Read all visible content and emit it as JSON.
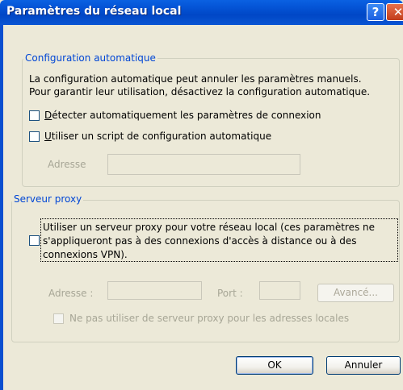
{
  "window": {
    "title": "Paramètres du réseau local",
    "help_label": "?",
    "close_label": "✕"
  },
  "auto_config": {
    "legend": "Configuration automatique",
    "description_line1": "La configuration automatique peut annuler les paramètres manuels.",
    "description_line2": "Pour garantir leur utilisation, désactivez la configuration automatique.",
    "detect_label_first": "D",
    "detect_label_rest": "étecter automatiquement les paramètres de connexion",
    "script_label_first": "U",
    "script_label_rest": "tiliser un script de configuration automatique",
    "address_label": "Adresse",
    "address_value": ""
  },
  "proxy": {
    "legend": "Serveur proxy",
    "use_proxy_line1": "Utiliser un serveur proxy pour votre réseau local (ces paramètres ne",
    "use_proxy_line2": "s'appliqueront pas à des connexions d'accès à distance ou à des",
    "use_proxy_line3": "connexions VPN).",
    "address_label": "Adresse :",
    "address_value": "",
    "port_label": "Port :",
    "port_value": "",
    "advanced_label": "Avancé...",
    "bypass_label": "Ne pas utiliser de serveur proxy pour les adresses locales"
  },
  "buttons": {
    "ok": "OK",
    "cancel": "Annuler"
  },
  "colors": {
    "title_bar": "#0A5ADB",
    "dialog_bg": "#ECE9D8",
    "group_label": "#0046D5"
  }
}
